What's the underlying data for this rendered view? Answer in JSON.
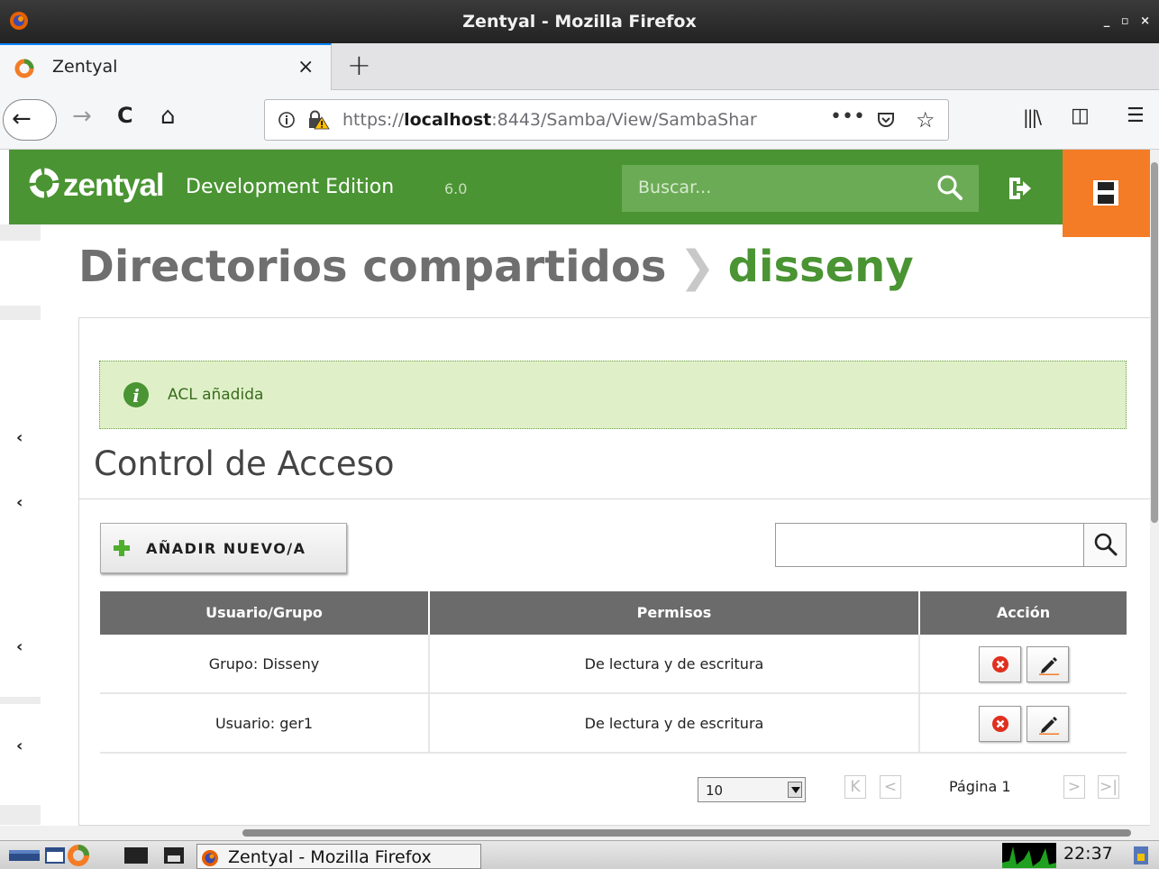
{
  "window": {
    "title": "Zentyal - Mozilla Firefox",
    "controls": "_ ▫ ×"
  },
  "tab": {
    "title": "Zentyal",
    "close": "×",
    "new_tab": "+"
  },
  "nav": {
    "back": "←",
    "forward": "→",
    "reload": "C",
    "home": "⌂",
    "url_prefix": "https://",
    "url_host": "localhost",
    "url_rest": ":8443/Samba/View/SambaShar",
    "page_actions": "•••",
    "bookmark": "☆",
    "library": "|||\\",
    "sidebar": "◫",
    "menu": "☰"
  },
  "zentyal": {
    "brand": "zentyal",
    "edition": "Development Edition",
    "version": "6.0",
    "search_placeholder": "Buscar...",
    "brand_color": "#4a9433",
    "save_color": "#f47c26"
  },
  "page": {
    "title_main": "Directorios compartidos",
    "title_sep": "❯",
    "title_sub": "disseny",
    "message": "ACL añadida",
    "section_title": "Control de Acceso",
    "add_button": "AÑADIR NUEVO/A"
  },
  "table": {
    "columns": [
      "Usuario/Grupo",
      "Permisos",
      "Acción"
    ],
    "rows": [
      {
        "user": "Grupo: Disseny",
        "perm": "De lectura y de escritura"
      },
      {
        "user": "Usuario: ger1",
        "perm": "De lectura y de escritura"
      }
    ]
  },
  "pagination": {
    "page_size": "10",
    "first": "K",
    "prev": "<",
    "page_label": "Página 1",
    "next": ">",
    "last": ">|"
  },
  "sidebar": {
    "chevron": "‹"
  },
  "taskbar": {
    "task_label": "Zentyal - Mozilla Firefox",
    "clock": "22:37"
  }
}
